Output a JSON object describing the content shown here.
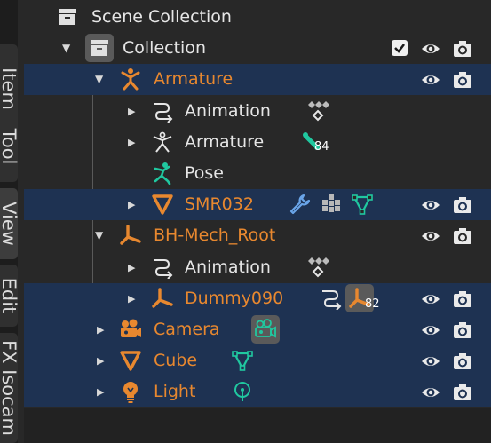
{
  "side_tabs": [
    "Item",
    "Tool",
    "View",
    "Edit",
    "FX Isocam"
  ],
  "outliner": {
    "scene_collection": "Scene Collection",
    "collection": "Collection",
    "rows": {
      "armature_obj": "Armature",
      "animation_1": "Animation",
      "armature_data": "Armature",
      "armature_bones_count": "84",
      "pose": "Pose",
      "smr032": "SMR032",
      "bh_mech_root": "BH-Mech_Root",
      "animation_2": "Animation",
      "dummy090": "Dummy090",
      "dummy_children_count": "82",
      "camera": "Camera",
      "cube": "Cube",
      "light": "Light"
    }
  },
  "colors": {
    "selected_row": "#1e3252",
    "object_orange": "#e8882f",
    "data_green": "#20c8a0",
    "modifier_blue": "#6aa5e8"
  }
}
